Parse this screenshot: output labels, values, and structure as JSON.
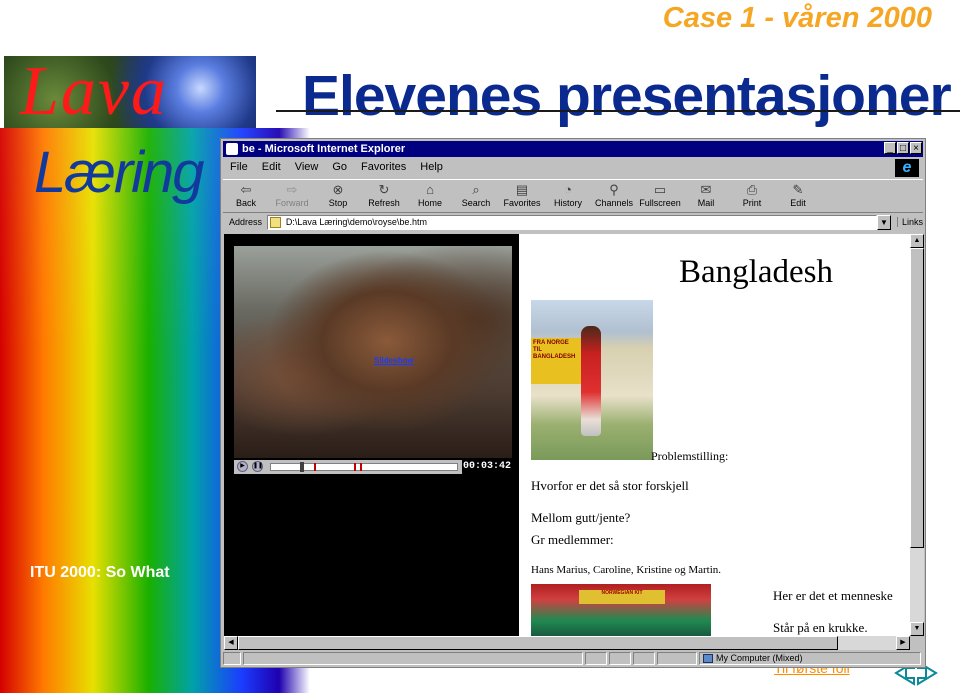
{
  "slide": {
    "case_label": "Case 1 - våren 2000",
    "title": "Elevenes presentasjoner",
    "logo_word": "Lava",
    "logo_sub": "Læring",
    "footer_label": "ITU 2000: So What",
    "first_slide_link": "Til første foil"
  },
  "browser": {
    "window_title": "be - Microsoft Internet Explorer",
    "menu": [
      "File",
      "Edit",
      "View",
      "Go",
      "Favorites",
      "Help"
    ],
    "toolbar": [
      {
        "label": "Back",
        "icon": "back-arrow-icon"
      },
      {
        "label": "Forward",
        "icon": "forward-arrow-icon"
      },
      {
        "label": "Stop",
        "icon": "stop-icon"
      },
      {
        "label": "Refresh",
        "icon": "refresh-icon"
      },
      {
        "label": "Home",
        "icon": "home-icon"
      },
      {
        "label": "Search",
        "icon": "search-icon"
      },
      {
        "label": "Favorites",
        "icon": "favorites-icon"
      },
      {
        "label": "History",
        "icon": "history-icon"
      },
      {
        "label": "Channels",
        "icon": "channels-icon"
      },
      {
        "label": "Fullscreen",
        "icon": "fullscreen-icon"
      },
      {
        "label": "Mail",
        "icon": "mail-icon"
      },
      {
        "label": "Print",
        "icon": "print-icon"
      },
      {
        "label": "Edit",
        "icon": "edit-icon"
      }
    ],
    "address_label": "Address",
    "address_value": "D:\\Lava Læring\\demo\\royse\\be.htm",
    "links_label": "Links",
    "status_zone": "My Computer (Mixed)"
  },
  "page": {
    "heading": "Bangladesh",
    "slideshow_link": "Slideshow",
    "video_time": "00:03:42",
    "problem_label": "Problemstilling:",
    "question_line1": "Hvorfor er det så stor forskjell",
    "question_line2": "Mellom gutt/jente?",
    "members_label": "Gr medlemmer:",
    "members": "Hans Marius, Caroline, Kristine og Martin.",
    "caption_line1": "Her er det et menneske",
    "caption_line2": "Står på en krukke.",
    "photo1_banner": "FRA NORGE TIL BANGLADESH",
    "photo2_banner": "NORWEGIAN KIT"
  },
  "colors": {
    "title_blue": "#0a2a8f",
    "case_orange": "#f5a623",
    "logo_red": "#ff1a1a",
    "titlebar_navy": "#000080"
  }
}
